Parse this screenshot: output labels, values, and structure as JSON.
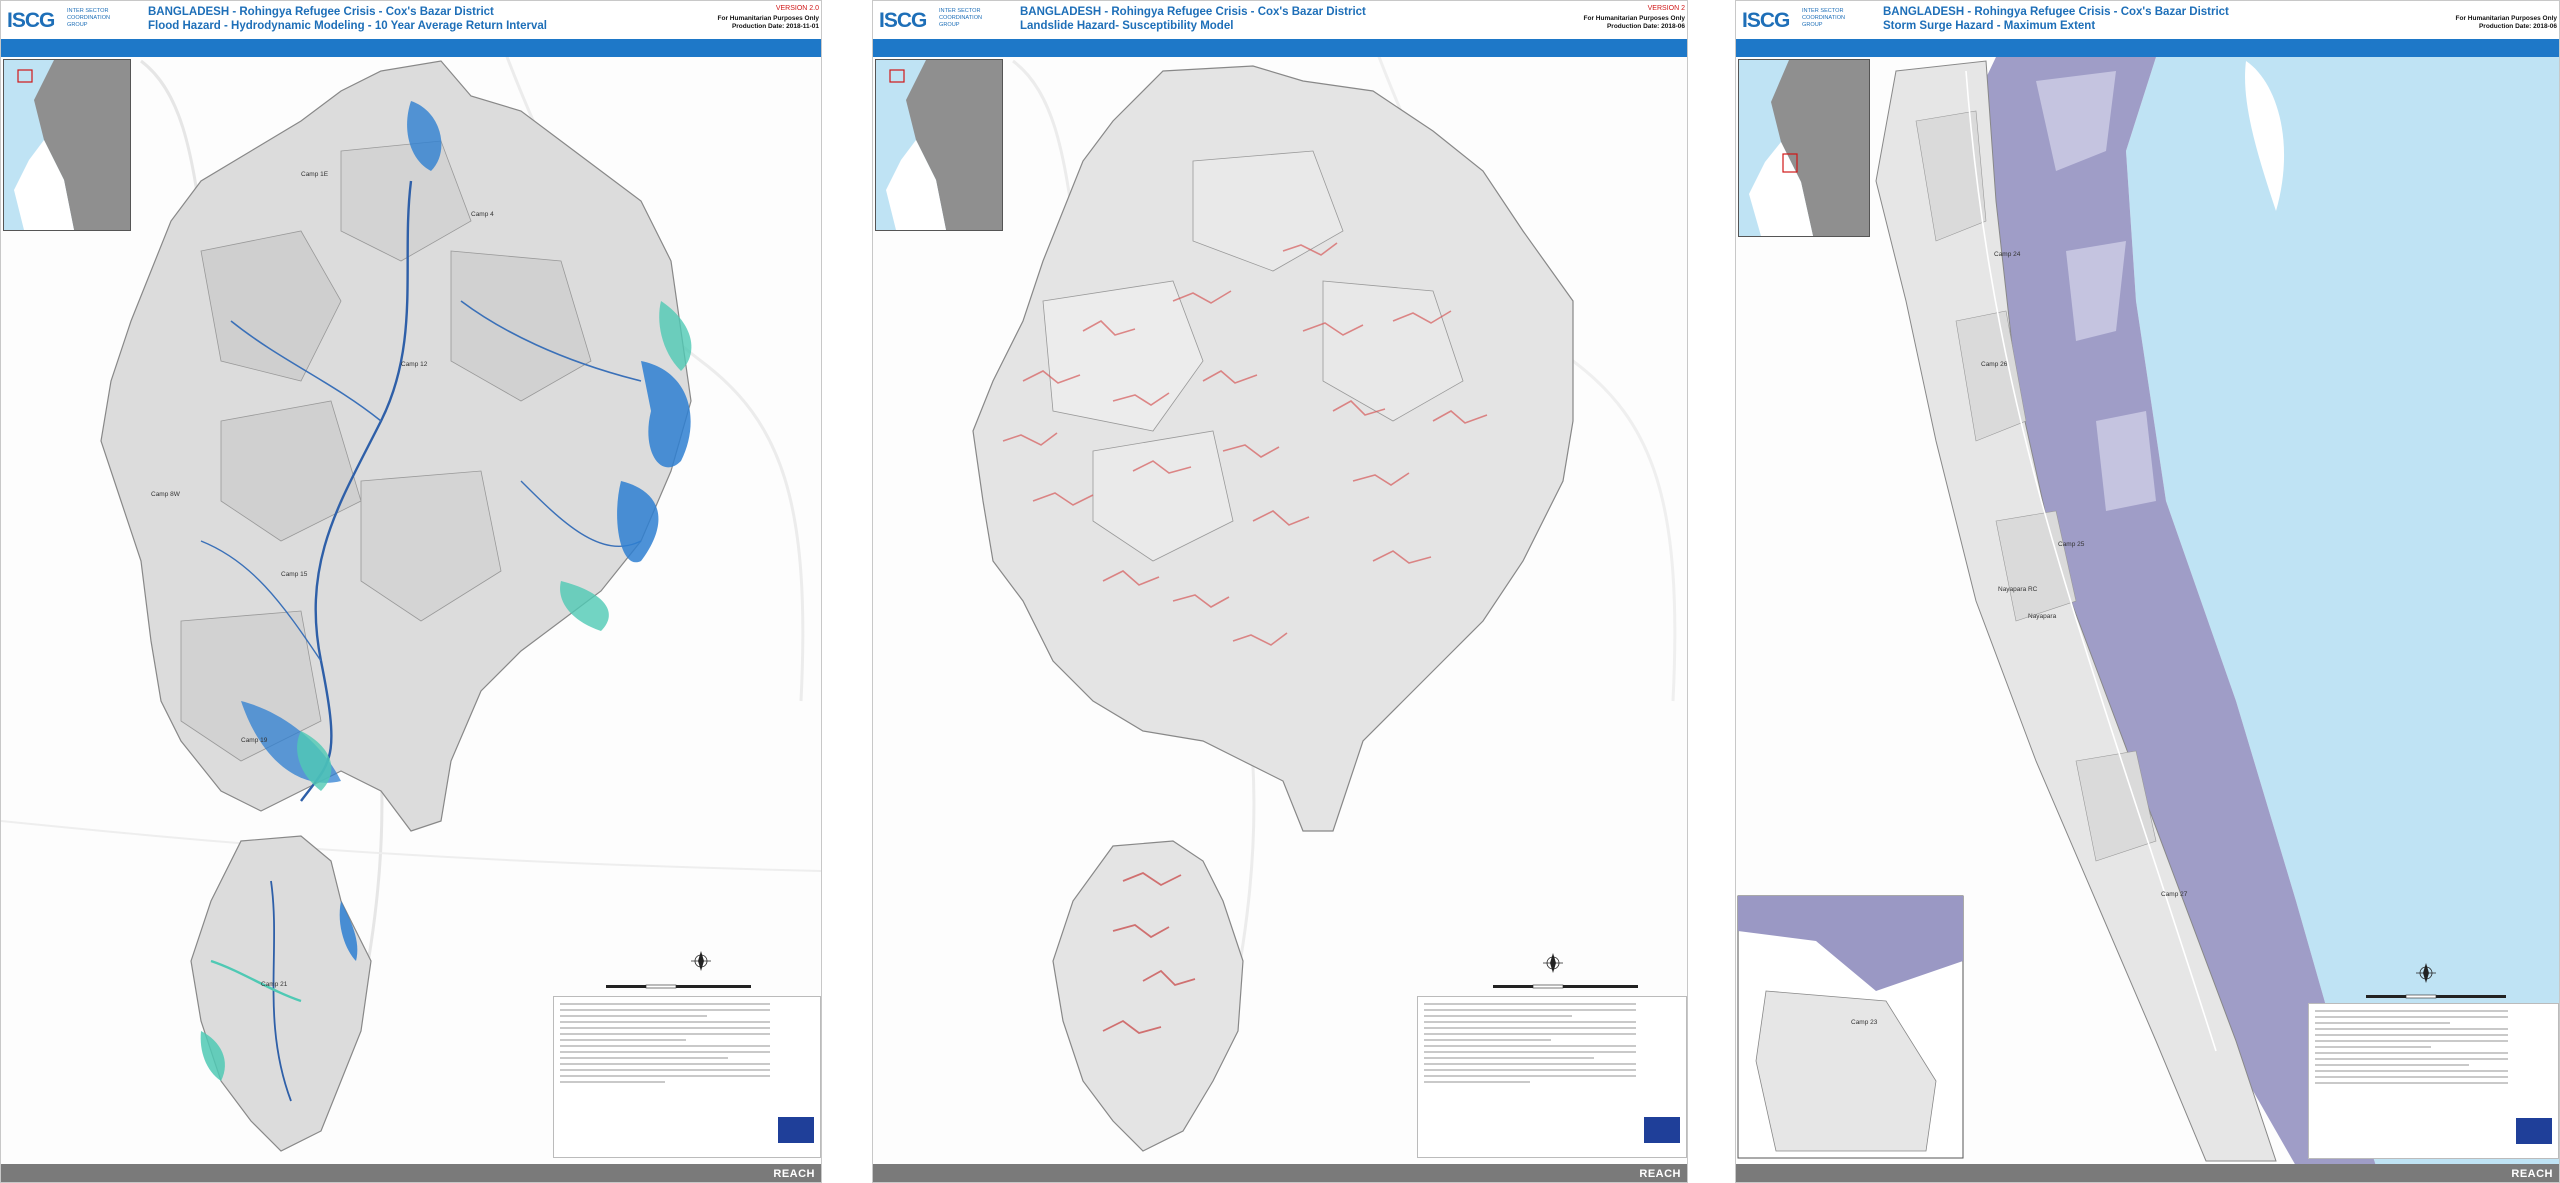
{
  "panels": [
    {
      "logo": "ISCG",
      "logo_sub": "INTER SECTOR COORDINATION GROUP",
      "title_line1": "BANGLADESH - Rohingya Refugee Crisis - Cox's Bazar District",
      "title_line2": "Flood Hazard - Hydrodynamic Modeling - 10 Year Average Return Interval",
      "version": "VERSION 2.0",
      "purpose": "For Humanitarian Purposes Only",
      "production": "Production Date: 2018-11-01",
      "footer_brand": "REACH",
      "hazard_color": "#2e7fd1",
      "camp_labels": [
        "Camp 1E",
        "Camp 4",
        "Camp 8W",
        "Camp 12",
        "Camp 15",
        "Camp 19",
        "Camp 21"
      ]
    },
    {
      "logo": "ISCG",
      "logo_sub": "INTER SECTOR COORDINATION GROUP",
      "title_line1": "BANGLADESH - Rohingya Refugee Crisis - Cox's Bazar District",
      "title_line2": "Landslide Hazard- Susceptibility Model",
      "version": "VERSION 2",
      "purpose": "For Humanitarian Purposes Only",
      "production": "Production Date: 2018-06",
      "footer_brand": "REACH",
      "hazard_color": "#d65b5b",
      "camp_labels": []
    },
    {
      "logo": "ISCG",
      "logo_sub": "INTER SECTOR COORDINATION GROUP",
      "title_line1": "BANGLADESH - Rohingya Refugee Crisis - Cox's Bazar District",
      "title_line2": "Storm Surge Hazard - Maximum Extent",
      "version": "",
      "purpose": "For Humanitarian Purposes Only",
      "production": "Production Date: 2018-06",
      "footer_brand": "REACH",
      "hazard_color": "#9a98c4",
      "camp_labels": [
        "Camp 24",
        "Camp 26",
        "Camp 25",
        "Nayapara RC",
        "Nayapara",
        "Camp 27",
        "Camp 23"
      ]
    }
  ]
}
